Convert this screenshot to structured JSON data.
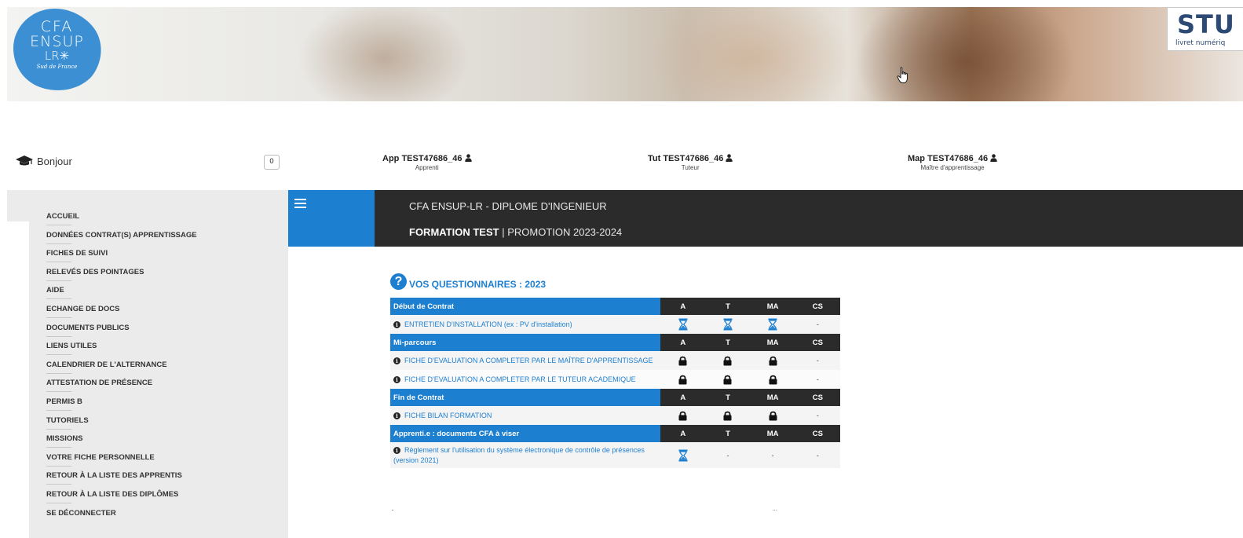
{
  "logo": {
    "line1": "CFA",
    "line2": "ENSUP",
    "line3": "LR✳",
    "line4": "Sud de France"
  },
  "stu_badge": {
    "title": "STU",
    "subtitle": "livret numériq"
  },
  "colors": {
    "accent": "#1d7fd0",
    "dark": "#2b2b2b",
    "sidebar_bg": "#ebebeb"
  },
  "userbar": {
    "greeting": "Bonjour",
    "notification_count": "0",
    "apprenti": {
      "name": "App TEST47686_46",
      "role": "Apprenti"
    },
    "tuteur": {
      "name": "Tut TEST47686_46",
      "role": "Tuteur"
    },
    "maitre": {
      "name": "Map TEST47686_46",
      "role": "Maître d'apprentissage"
    }
  },
  "sidebar": {
    "items": [
      "ACCUEIL",
      "DONNÉES CONTRAT(S) APPRENTISSAGE",
      "FICHES DE SUIVI",
      "RELEVÉS DES POINTAGES",
      "AIDE",
      "ECHANGE DE DOCS",
      "DOCUMENTS PUBLICS",
      "LIENS UTILES",
      "CALENDRIER DE L'ALTERNANCE",
      "ATTESTATION DE PRÉSENCE",
      "PERMIS B",
      "TUTORIELS",
      "MISSIONS",
      "VOTRE FICHE PERSONNELLE",
      "RETOUR À LA LISTE DES APPRENTIS",
      "RETOUR À LA LISTE DES DIPLÔMES",
      "SE DÉCONNECTER"
    ]
  },
  "header": {
    "line1": "CFA ENSUP-LR - DIPLOME D'INGENIEUR",
    "formation": "FORMATION TEST",
    "separator": " | ",
    "promotion": "PROMOTION 2023-2024"
  },
  "questionnaires": {
    "heading": "VOS QUESTIONNAIRES : 2023",
    "columns": [
      "A",
      "T",
      "MA",
      "CS"
    ],
    "sections": [
      {
        "title": "Début de Contrat",
        "items": [
          {
            "label": "ENTRETIEN D'INSTALLATION (ex : PV d'installation)",
            "status": [
              "hourglass",
              "hourglass",
              "hourglass",
              "-"
            ]
          }
        ]
      },
      {
        "title": "Mi-parcours",
        "items": [
          {
            "label": "FICHE D'EVALUATION A COMPLETER PAR LE MAÎTRE D'APPRENTISSAGE",
            "status": [
              "lock",
              "lock",
              "lock",
              "-"
            ]
          },
          {
            "label": "FICHE D'EVALUATION A COMPLETER PAR LE TUTEUR ACADEMIQUE",
            "status": [
              "lock",
              "lock",
              "lock",
              "-"
            ]
          }
        ]
      },
      {
        "title": "Fin de Contrat",
        "items": [
          {
            "label": "FICHE BILAN FORMATION",
            "status": [
              "lock",
              "lock",
              "lock",
              "-"
            ]
          }
        ]
      },
      {
        "title": "Apprenti.e : documents CFA à viser",
        "items": [
          {
            "label": "Règlement sur l'utilisation du système électronique de contrôle de présences (version 2021)",
            "status": [
              "hourglass",
              "-",
              "-",
              "-"
            ]
          }
        ]
      }
    ]
  }
}
